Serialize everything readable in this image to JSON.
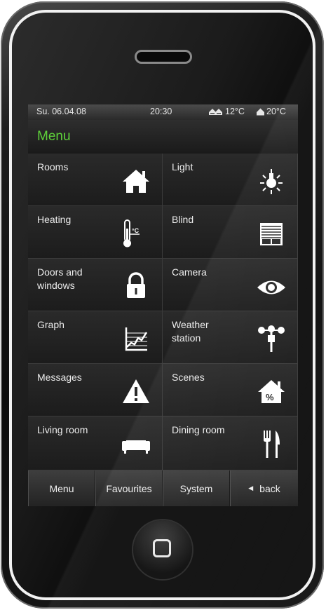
{
  "status_bar": {
    "date": "Su. 06.04.08",
    "time": "20:30",
    "outdoor_temp": "12°C",
    "indoor_temp": "20°C"
  },
  "page_title": "Menu",
  "accent_color": "#5ed13a",
  "tiles": [
    {
      "label": "Rooms",
      "icon": "house-icon"
    },
    {
      "label": "Light",
      "icon": "light-bulb-icon"
    },
    {
      "label": "Heating",
      "icon": "thermometer-icon"
    },
    {
      "label": "Blind",
      "icon": "blind-icon"
    },
    {
      "label": "Doors and\nwindows",
      "icon": "padlock-icon"
    },
    {
      "label": "Camera",
      "icon": "eye-icon"
    },
    {
      "label": "Graph",
      "icon": "graph-icon"
    },
    {
      "label": "Weather\nstation",
      "icon": "anemometer-icon"
    },
    {
      "label": "Messages",
      "icon": "warning-icon"
    },
    {
      "label": "Scenes",
      "icon": "house-percent-icon"
    },
    {
      "label": "Living room",
      "icon": "sofa-icon"
    },
    {
      "label": "Dining room",
      "icon": "cutlery-icon"
    }
  ],
  "thermometer_unit": "°C",
  "scenes_symbol": "%",
  "nav": {
    "menu": "Menu",
    "favourites": "Favourites",
    "system": "System",
    "back": "back"
  }
}
